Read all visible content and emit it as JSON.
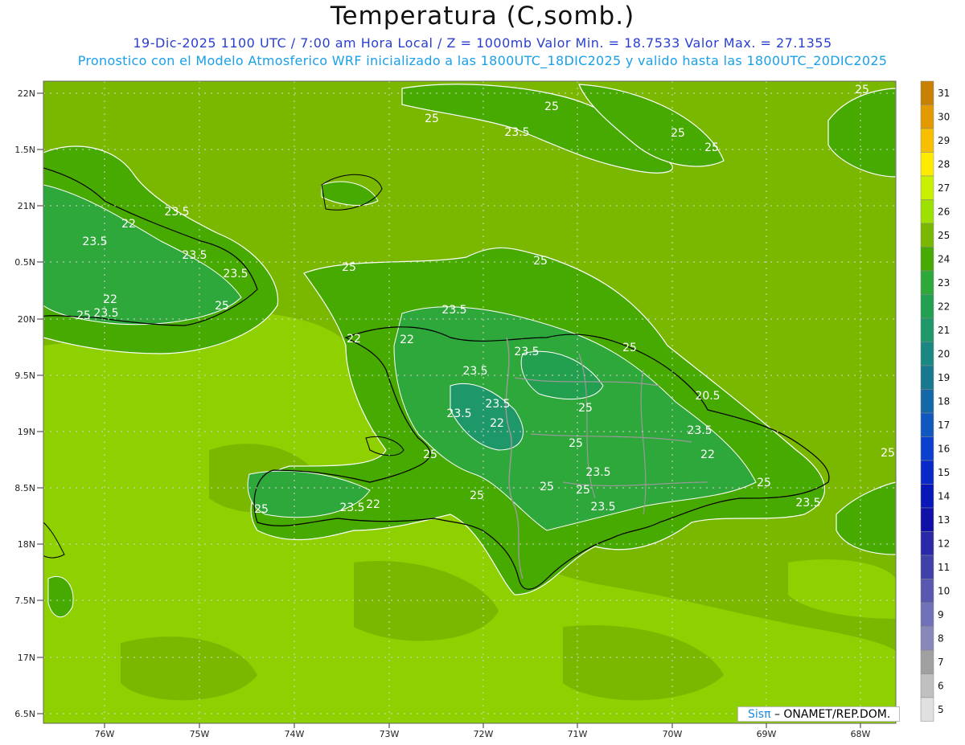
{
  "header": {
    "title": "Temperatura (C,somb.)",
    "line1": "19-Dic-2025  1100 UTC / 7:00 am Hora Local / Z = 1000mb   Valor Min. = 18.7533  Valor Max. = 27.1355",
    "line2": "Pronostico con el Modelo Atmosferico WRF inicializado a las 1800UTC_18DIC2025 y valido hasta las  1800UTC_20DIC2025"
  },
  "lat_labels": [
    "22N",
    "1.5N",
    "21N",
    "0.5N",
    "20N",
    "9.5N",
    "19N",
    "8.5N",
    "18N",
    "7.5N",
    "17N",
    "6.5N"
  ],
  "lon_labels": [
    "76W",
    "75W",
    "74W",
    "73W",
    "72W",
    "71W",
    "70W",
    "69W",
    "68W"
  ],
  "contour_labels": [
    "25",
    "25",
    "25",
    "23.5",
    "25",
    "25",
    "23.5",
    "22",
    "23.5",
    "23.5",
    "25",
    "25",
    "23.5",
    "22",
    "25",
    "25",
    "23.5",
    "23.5",
    "22",
    "22",
    "23.5",
    "25",
    "23.5",
    "20.5",
    "23.5",
    "23.5",
    "25",
    "22",
    "25",
    "23.5",
    "25",
    "22",
    "23.5",
    "25",
    "25",
    "25",
    "25",
    "23.5",
    "23.5",
    "22",
    "23.5",
    "25",
    "25"
  ],
  "colorbar": {
    "levels": [
      "31",
      "30",
      "29",
      "28",
      "27",
      "26",
      "25",
      "24",
      "23",
      "22",
      "21",
      "20",
      "19",
      "18",
      "17",
      "16",
      "15",
      "14",
      "13",
      "12",
      "11",
      "10",
      "9",
      "8",
      "7",
      "6",
      "5"
    ],
    "colors": [
      "#c88000",
      "#e39a00",
      "#f8bf00",
      "#ffeb00",
      "#c8f000",
      "#9ee000",
      "#7ab800",
      "#46aa00",
      "#2ea83a",
      "#22a050",
      "#1e9868",
      "#1a8880",
      "#187890",
      "#1468a8",
      "#1058c0",
      "#0a40d0",
      "#0828c8",
      "#0818b8",
      "#1010a8",
      "#2828a8",
      "#4040a8",
      "#5858b0",
      "#7070b8",
      "#8888b8",
      "#a0a0a0",
      "#c0c0c0",
      "#e0e0e0"
    ]
  },
  "credit": {
    "brand": "Sisπ",
    "text": "– ONAMET/REP.DOM."
  }
}
